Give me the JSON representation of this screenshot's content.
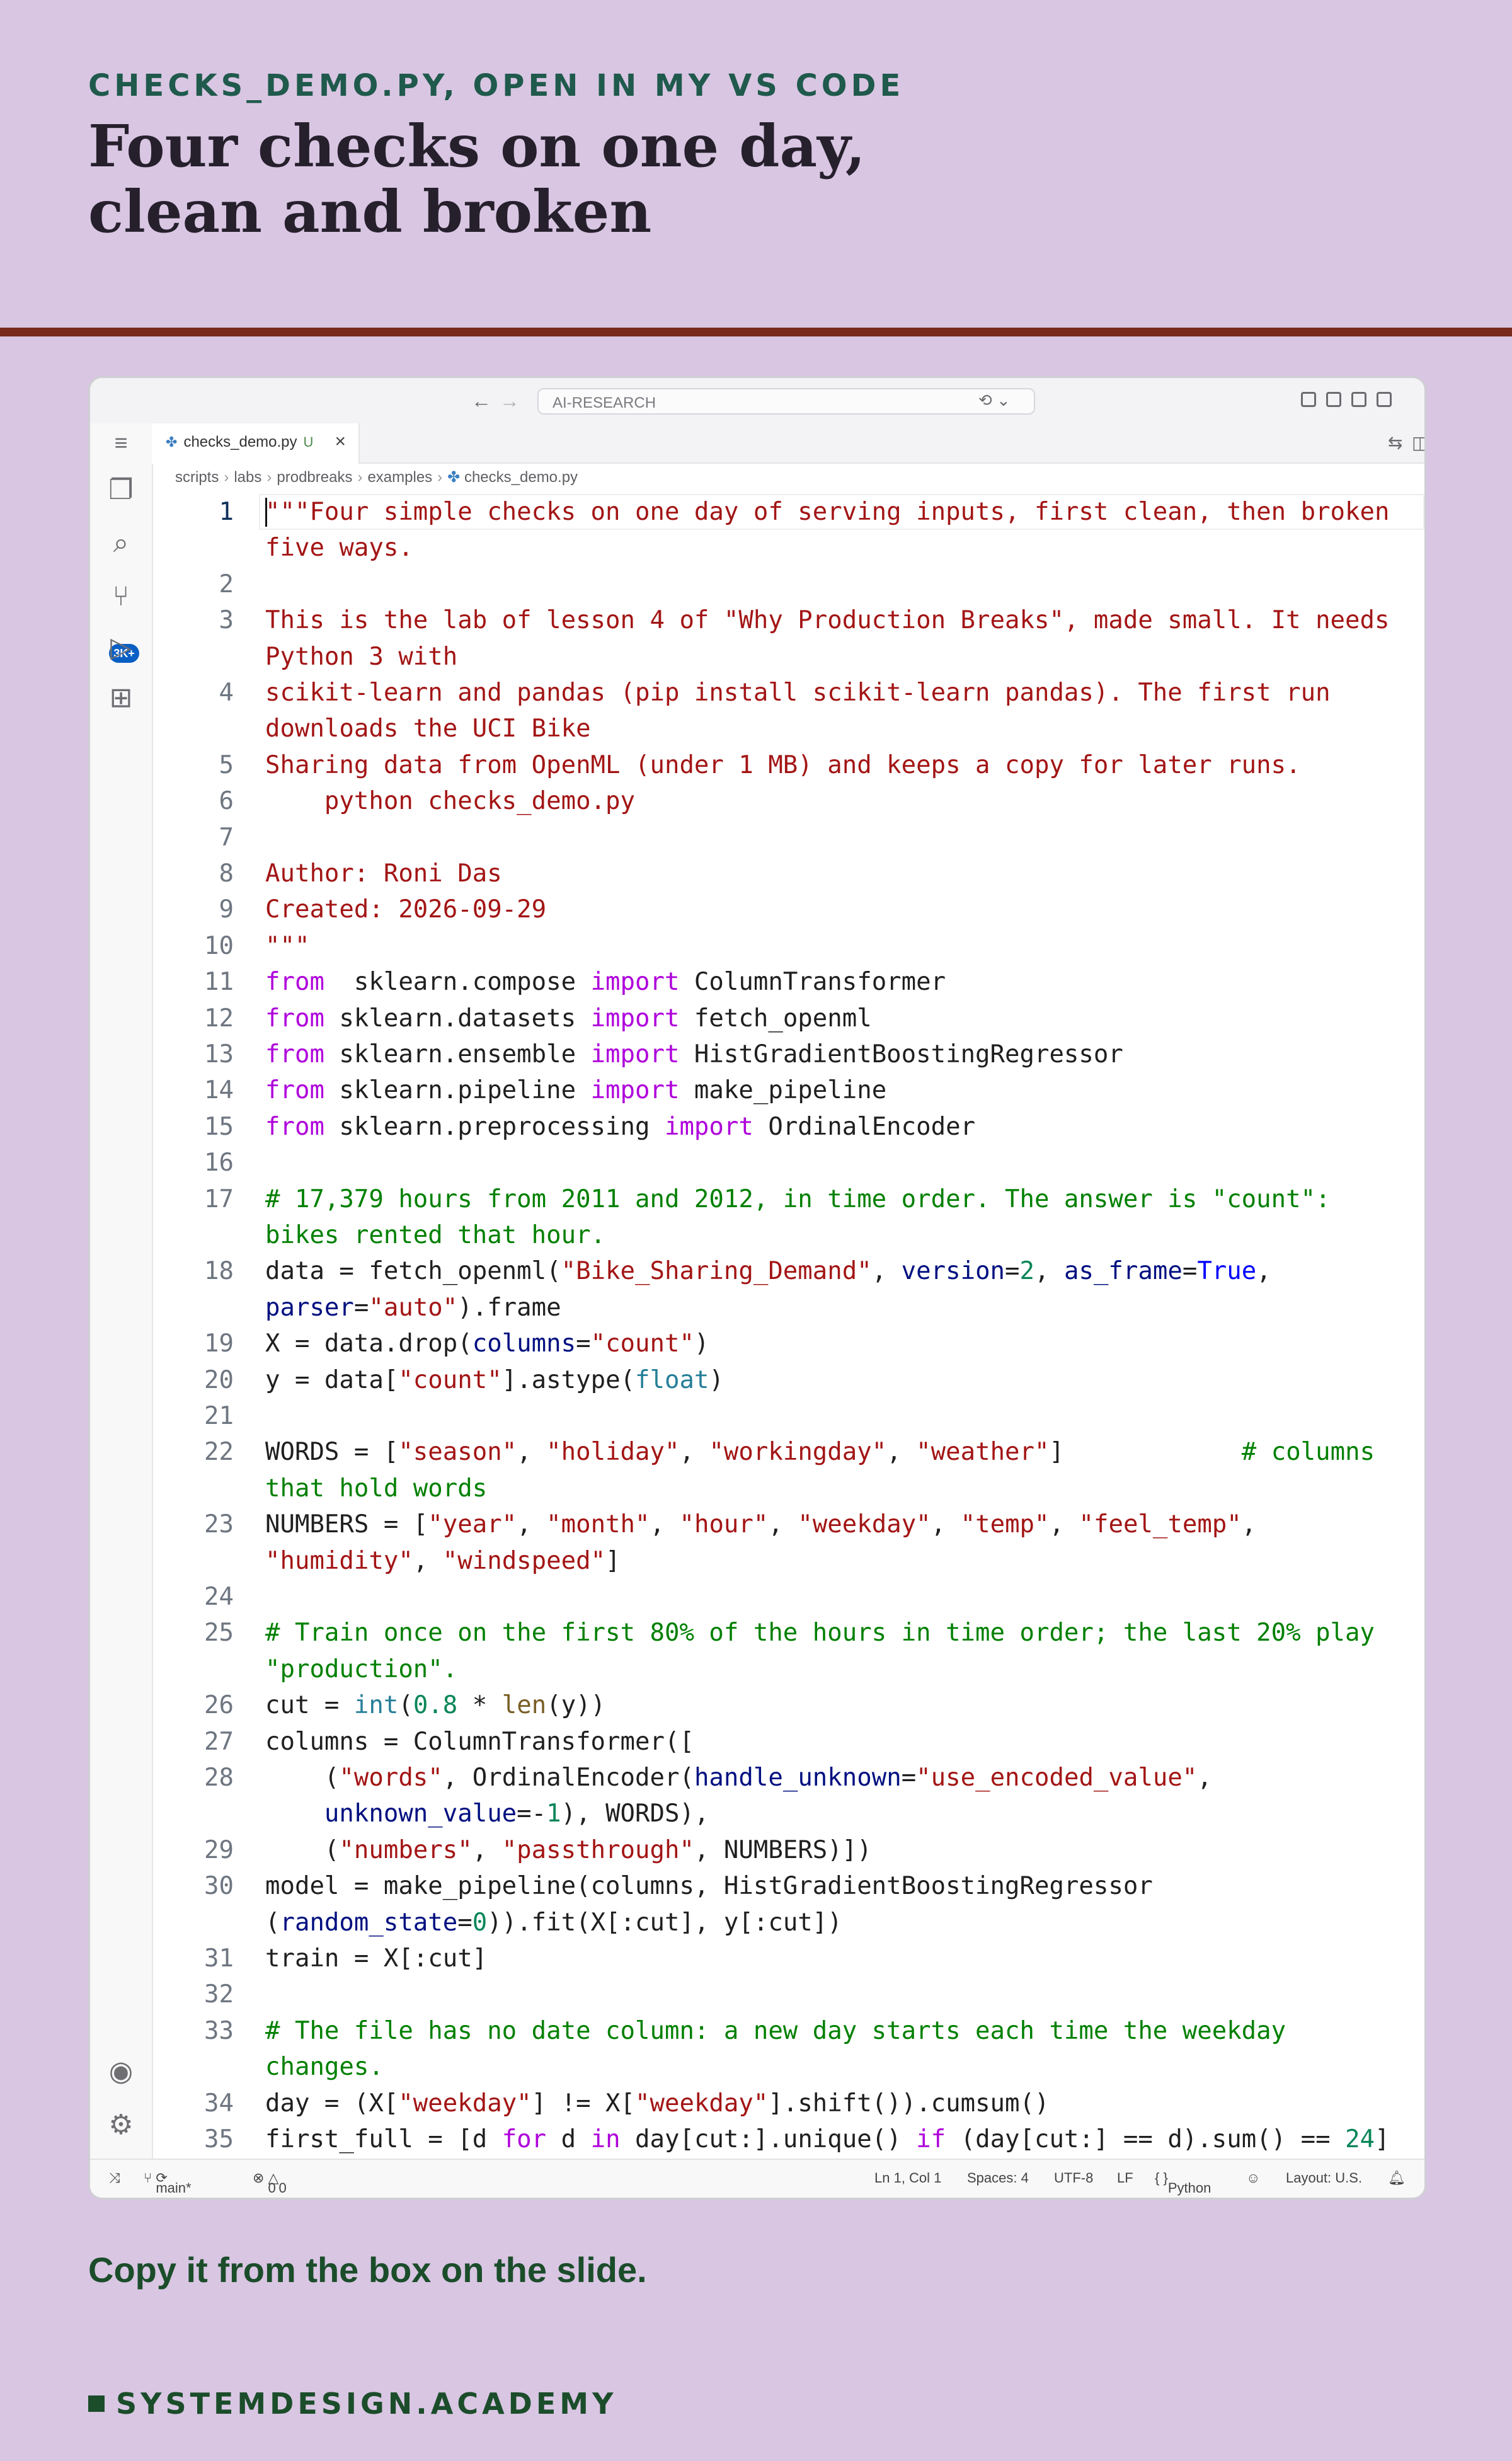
{
  "slide": {
    "kicker": "CHECKS_DEMO.PY, OPEN IN MY VS CODE",
    "title": "Four checks on one day, clean and broken",
    "footer": "Copy it from the box on the slide.",
    "brand": "SYSTEMDESIGN.ACADEMY"
  },
  "window": {
    "search": "AI-RESEARCH",
    "badge": "3K+"
  },
  "tab": {
    "label": "checks_demo.py",
    "modified": "U"
  },
  "breadcrumb": [
    "scripts",
    "labs",
    "prodbreaks",
    "examples",
    "checks_demo.py"
  ],
  "code": {
    "lines": [
      {
        "n": "1",
        "row": 0
      },
      {
        "n": "",
        "row": 1
      },
      {
        "n": "2",
        "row": 2
      },
      {
        "n": "3",
        "row": 3
      },
      {
        "n": "",
        "row": 4
      },
      {
        "n": "4",
        "row": 5
      },
      {
        "n": "",
        "row": 6
      },
      {
        "n": "5",
        "row": 7
      },
      {
        "n": "6",
        "row": 8
      },
      {
        "n": "7",
        "row": 9
      },
      {
        "n": "8",
        "row": 10
      },
      {
        "n": "9",
        "row": 11
      },
      {
        "n": "10",
        "row": 12
      },
      {
        "n": "11",
        "row": 13
      },
      {
        "n": "12",
        "row": 14
      },
      {
        "n": "13",
        "row": 15
      },
      {
        "n": "14",
        "row": 16
      },
      {
        "n": "15",
        "row": 17
      },
      {
        "n": "16",
        "row": 18
      },
      {
        "n": "17",
        "row": 19
      },
      {
        "n": "",
        "row": 20
      },
      {
        "n": "18",
        "row": 21
      },
      {
        "n": "",
        "row": 22
      },
      {
        "n": "19",
        "row": 23
      },
      {
        "n": "20",
        "row": 24
      },
      {
        "n": "21",
        "row": 25
      },
      {
        "n": "22",
        "row": 26
      },
      {
        "n": "",
        "row": 27
      },
      {
        "n": "23",
        "row": 28
      },
      {
        "n": "",
        "row": 29
      },
      {
        "n": "24",
        "row": 30
      },
      {
        "n": "25",
        "row": 31
      },
      {
        "n": "",
        "row": 32
      },
      {
        "n": "26",
        "row": 33
      },
      {
        "n": "27",
        "row": 34
      },
      {
        "n": "28",
        "row": 35
      },
      {
        "n": "",
        "row": 36
      },
      {
        "n": "29",
        "row": 37
      },
      {
        "n": "30",
        "row": 38
      },
      {
        "n": "",
        "row": 39
      },
      {
        "n": "31",
        "row": 40
      },
      {
        "n": "32",
        "row": 41
      },
      {
        "n": "33",
        "row": 42
      },
      {
        "n": "",
        "row": 43
      },
      {
        "n": "34",
        "row": 44
      },
      {
        "n": "35",
        "row": 45
      }
    ],
    "text": [
      [
        [
          "s",
          "\"\"\"Four simple checks on one day of serving inputs, first clean, then broken"
        ]
      ],
      [
        [
          "s",
          "five ways."
        ]
      ],
      [],
      [
        [
          "s",
          "This is the lab of lesson 4 of \"Why Production Breaks\", made small. It needs"
        ]
      ],
      [
        [
          "s",
          "Python 3 with"
        ]
      ],
      [
        [
          "s",
          "scikit-learn and pandas (pip install scikit-learn pandas). The first run"
        ]
      ],
      [
        [
          "s",
          "downloads the UCI Bike"
        ]
      ],
      [
        [
          "s",
          "Sharing data from OpenML (under 1 MB) and keeps a copy for later runs."
        ]
      ],
      [
        [
          "s",
          "    python checks_demo.py"
        ]
      ],
      [],
      [
        [
          "s",
          "Author: Roni Das"
        ]
      ],
      [
        [
          "s",
          "Created: 2026-09-29"
        ]
      ],
      [
        [
          "s",
          "\"\"\""
        ]
      ],
      [
        [
          "k",
          "from"
        ],
        [
          "",
          "  sklearn.compose "
        ],
        [
          "k",
          "import"
        ],
        [
          "",
          " ColumnTransformer"
        ]
      ],
      [
        [
          "k",
          "from"
        ],
        [
          "",
          " sklearn.datasets "
        ],
        [
          "k",
          "import"
        ],
        [
          "",
          " fetch_openml"
        ]
      ],
      [
        [
          "k",
          "from"
        ],
        [
          "",
          " sklearn.ensemble "
        ],
        [
          "k",
          "import"
        ],
        [
          "",
          " HistGradientBoostingRegressor"
        ]
      ],
      [
        [
          "k",
          "from"
        ],
        [
          "",
          " sklearn.pipeline "
        ],
        [
          "k",
          "import"
        ],
        [
          "",
          " make_pipeline"
        ]
      ],
      [
        [
          "k",
          "from"
        ],
        [
          "",
          " sklearn.preprocessing "
        ],
        [
          "k",
          "import"
        ],
        [
          "",
          " OrdinalEncoder"
        ]
      ],
      [],
      [
        [
          "c",
          "# 17,379 hours from 2011 and 2012, in time order. The answer is \"count\":"
        ]
      ],
      [
        [
          "c",
          "bikes rented that hour."
        ]
      ],
      [
        [
          "",
          "data = fetch_openml("
        ],
        [
          "s",
          "\"Bike_Sharing_Demand\""
        ],
        [
          "",
          ", "
        ],
        [
          "p",
          "version"
        ],
        [
          "",
          "="
        ],
        [
          "n",
          "2"
        ],
        [
          "",
          ", "
        ],
        [
          "p",
          "as_frame"
        ],
        [
          "",
          "="
        ],
        [
          "b",
          "True"
        ],
        [
          "",
          ","
        ]
      ],
      [
        [
          "p",
          "parser"
        ],
        [
          "",
          "="
        ],
        [
          "s",
          "\"auto\""
        ],
        [
          "",
          ").frame"
        ]
      ],
      [
        [
          "",
          "X = data.drop("
        ],
        [
          "p",
          "columns"
        ],
        [
          "",
          "="
        ],
        [
          "s",
          "\"count\""
        ],
        [
          "",
          ")"
        ]
      ],
      [
        [
          "",
          "y = data["
        ],
        [
          "s",
          "\"count\""
        ],
        [
          "",
          "].astype("
        ],
        [
          "t",
          "float"
        ],
        [
          "",
          ")"
        ]
      ],
      [],
      [
        [
          "",
          "WORDS = ["
        ],
        [
          "s",
          "\"season\""
        ],
        [
          "",
          ", "
        ],
        [
          "s",
          "\"holiday\""
        ],
        [
          "",
          ", "
        ],
        [
          "s",
          "\"workingday\""
        ],
        [
          "",
          ", "
        ],
        [
          "s",
          "\"weather\""
        ],
        [
          "",
          "]            "
        ],
        [
          "c",
          "# columns"
        ]
      ],
      [
        [
          "c",
          "that hold words"
        ]
      ],
      [
        [
          "",
          "NUMBERS = ["
        ],
        [
          "s",
          "\"year\""
        ],
        [
          "",
          ", "
        ],
        [
          "s",
          "\"month\""
        ],
        [
          "",
          ", "
        ],
        [
          "s",
          "\"hour\""
        ],
        [
          "",
          ", "
        ],
        [
          "s",
          "\"weekday\""
        ],
        [
          "",
          ", "
        ],
        [
          "s",
          "\"temp\""
        ],
        [
          "",
          ", "
        ],
        [
          "s",
          "\"feel_temp\""
        ],
        [
          "",
          ","
        ]
      ],
      [
        [
          "s",
          "\"humidity\""
        ],
        [
          "",
          ", "
        ],
        [
          "s",
          "\"windspeed\""
        ],
        [
          "",
          "]"
        ]
      ],
      [],
      [
        [
          "c",
          "# Train once on the first 80% of the hours in time order; the last 20% play"
        ]
      ],
      [
        [
          "c",
          "\"production\"."
        ]
      ],
      [
        [
          "",
          "cut = "
        ],
        [
          "t",
          "int"
        ],
        [
          "",
          "("
        ],
        [
          "n",
          "0.8"
        ],
        [
          "",
          " * "
        ],
        [
          "f",
          "len"
        ],
        [
          "",
          "(y))"
        ]
      ],
      [
        [
          "",
          "columns = ColumnTransformer(["
        ]
      ],
      [
        [
          "",
          "    ("
        ],
        [
          "s",
          "\"words\""
        ],
        [
          "",
          ", OrdinalEncoder("
        ],
        [
          "p",
          "handle_unknown"
        ],
        [
          "",
          "="
        ],
        [
          "s",
          "\"use_encoded_value\""
        ],
        [
          "",
          ","
        ]
      ],
      [
        [
          "",
          "    "
        ],
        [
          "p",
          "unknown_value"
        ],
        [
          "",
          "=-"
        ],
        [
          "n",
          "1"
        ],
        [
          "",
          "), WORDS),"
        ]
      ],
      [
        [
          "",
          "    ("
        ],
        [
          "s",
          "\"numbers\""
        ],
        [
          "",
          ", "
        ],
        [
          "s",
          "\"passthrough\""
        ],
        [
          "",
          ", NUMBERS)])"
        ]
      ],
      [
        [
          "",
          "model = make_pipeline(columns, HistGradientBoostingRegressor"
        ]
      ],
      [
        [
          "",
          "("
        ],
        [
          "p",
          "random_state"
        ],
        [
          "",
          "="
        ],
        [
          "n",
          "0"
        ],
        [
          "",
          "))"
        ],
        [
          "",
          ".fit(X[:cut], y[:cut])"
        ]
      ],
      [
        [
          "",
          "train = X[:cut]"
        ]
      ],
      [],
      [
        [
          "c",
          "# The file has no date column: a new day starts each time the weekday"
        ]
      ],
      [
        [
          "c",
          "changes."
        ]
      ],
      [
        [
          "",
          "day = (X["
        ],
        [
          "s",
          "\"weekday\""
        ],
        [
          "",
          "] != X["
        ],
        [
          "s",
          "\"weekday\""
        ],
        [
          "",
          "].shift()).cumsum()"
        ]
      ],
      [
        [
          "",
          "first_full = [d "
        ],
        [
          "k",
          "for"
        ],
        [
          "",
          " d "
        ],
        [
          "k",
          "in"
        ],
        [
          "",
          " day[cut:].unique() "
        ],
        [
          "k",
          "if"
        ],
        [
          "",
          " (day[cut:] == d).sum() == "
        ],
        [
          "n",
          "24"
        ],
        [
          "",
          "]"
        ]
      ]
    ]
  },
  "status": {
    "branch": "main*",
    "problems": "0",
    "warnings": "0",
    "position": "Ln 1, Col 1",
    "spaces": "Spaces: 4",
    "encoding": "UTF-8",
    "eol": "LF",
    "language": "Python",
    "layout": "Layout: U.S."
  },
  "colors": {
    "background": "#d9c6e3",
    "rule": "#7a2a1c",
    "brand": "#1b4d2a"
  }
}
